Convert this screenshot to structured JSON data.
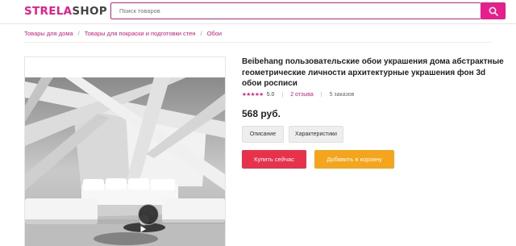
{
  "header": {
    "logo_part1": "STRELA",
    "logo_part2": "SHOP",
    "search_placeholder": "Поиск товаров",
    "search_icon": "search-icon",
    "accent_color": "#e91e8c"
  },
  "breadcrumb": {
    "items": [
      "Товары для дома",
      "Товары для покраски и подготовки стен",
      "Обои"
    ],
    "separator": "/"
  },
  "gallery": {
    "video_icon": "play-icon"
  },
  "product": {
    "title": "Beibehang пользовательские обои украшения дома абстрактные геометрические личности архитектурные украшения фон 3d обои росписи",
    "stars": "★★★★★",
    "rating": "5.0",
    "reviews": "2 отзыва",
    "orders": "5 заказов",
    "price": "568 руб.",
    "tabs": [
      "Описание",
      "Характеристики"
    ],
    "buy_label": "Купить сейчас",
    "cart_label": "Добавить в корзину",
    "buy_color": "#e8324c",
    "cart_color": "#f5a51c"
  }
}
